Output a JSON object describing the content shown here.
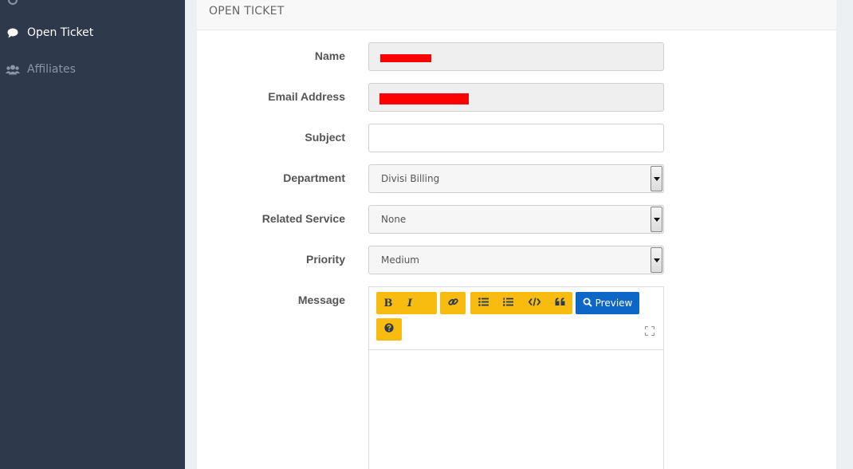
{
  "sidebar": {
    "items": [
      {
        "label": ""
      },
      {
        "label": "Open Ticket",
        "icon": "chat-bubble-icon"
      },
      {
        "label": "Affiliates",
        "icon": "users-icon"
      }
    ]
  },
  "panel": {
    "title": "OPEN TICKET"
  },
  "form": {
    "name_label": "Name",
    "email_label": "Email Address",
    "subject_label": "Subject",
    "subject_value": "",
    "department_label": "Department",
    "department_value": "Divisi Billing",
    "service_label": "Related Service",
    "service_value": "None",
    "priority_label": "Priority",
    "priority_value": "Medium",
    "message_label": "Message"
  },
  "editor": {
    "bold": "B",
    "italic": "I",
    "preview_label": "Preview",
    "icons": [
      "bold-icon",
      "italic-icon",
      "link-icon",
      "unordered-list-icon",
      "ordered-list-icon",
      "code-icon",
      "quote-icon",
      "help-icon",
      "search-icon",
      "fullscreen-icon"
    ]
  },
  "colors": {
    "sidebar_bg": "#2e3a4b",
    "toolbar_yellow": "#f7bc0f",
    "preview_blue": "#0e66c6",
    "redaction": "#ff0000"
  }
}
